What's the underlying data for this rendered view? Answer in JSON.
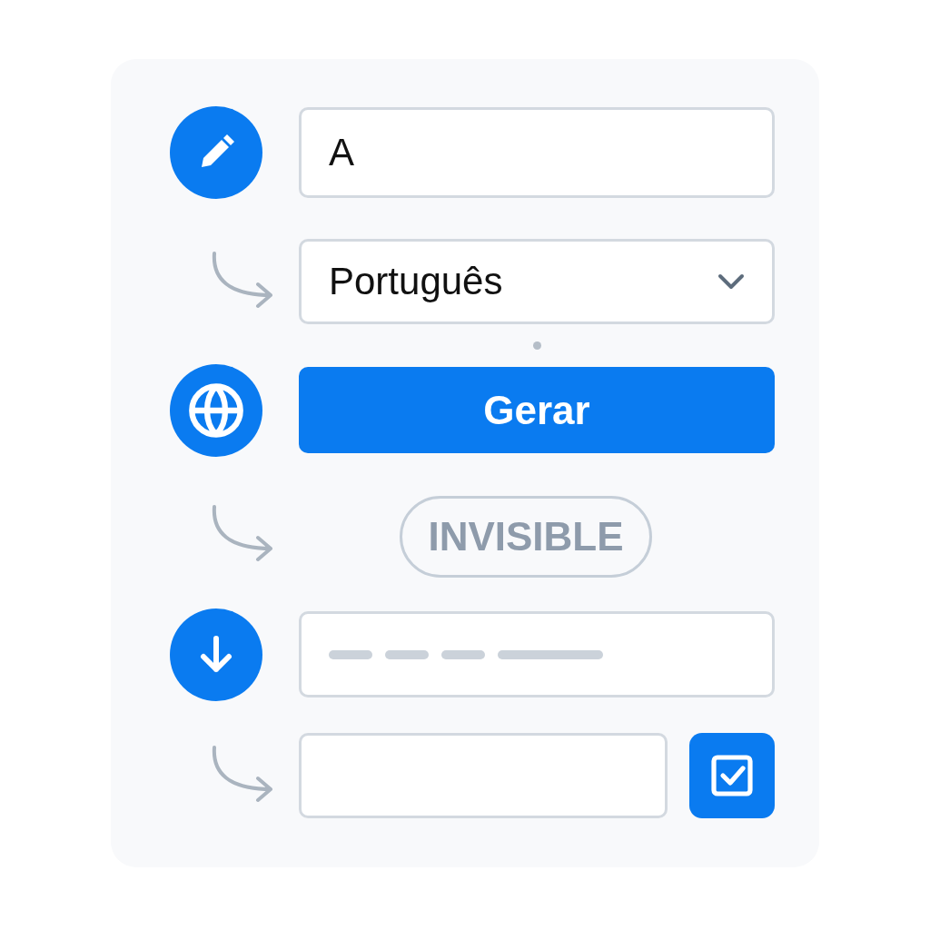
{
  "name_field": {
    "value": "A"
  },
  "language_select": {
    "value": "Português"
  },
  "generate_button": {
    "label": "Gerar"
  },
  "status_badge": {
    "label": "INVISIBLE"
  },
  "output_field": {
    "kind": "placeholder-lines"
  },
  "confirm": {
    "checked": true
  }
}
